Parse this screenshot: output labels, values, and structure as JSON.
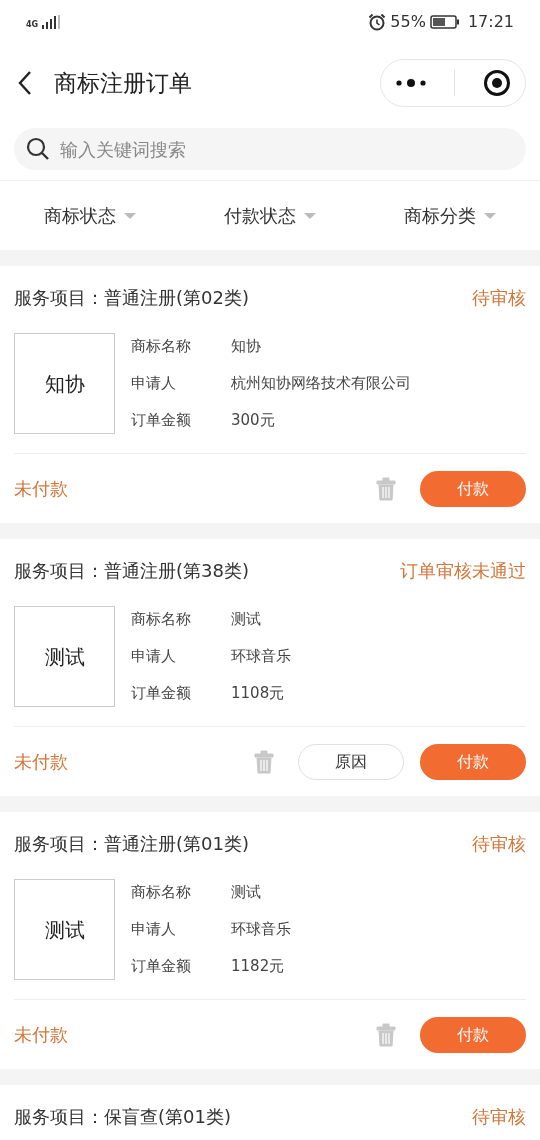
{
  "status_bar": {
    "network": "4G",
    "battery": "55%",
    "time": "17:21"
  },
  "header": {
    "title": "商标注册订单"
  },
  "search": {
    "placeholder": "输入关键词搜索"
  },
  "filters": [
    {
      "label": "商标状态"
    },
    {
      "label": "付款状态"
    },
    {
      "label": "商标分类"
    }
  ],
  "orders": [
    {
      "service_label": "服务项目：",
      "service": "普通注册(第02类)",
      "status": "待审核",
      "logo_text": "知协",
      "fields": [
        {
          "label": "商标名称",
          "value": "知协"
        },
        {
          "label": "申请人",
          "value": "杭州知协网络技术有限公司"
        },
        {
          "label": "订单金额",
          "value": "300元"
        }
      ],
      "payment_status": "未付款",
      "buttons": [
        {
          "kind": "delete"
        },
        {
          "kind": "pay",
          "label": "付款"
        }
      ]
    },
    {
      "service_label": "服务项目：",
      "service": "普通注册(第38类)",
      "status": "订单审核未通过",
      "logo_text": "测试",
      "fields": [
        {
          "label": "商标名称",
          "value": "测试"
        },
        {
          "label": "申请人",
          "value": "环球音乐"
        },
        {
          "label": "订单金额",
          "value": "1108元"
        }
      ],
      "payment_status": "未付款",
      "buttons": [
        {
          "kind": "delete"
        },
        {
          "kind": "reason",
          "label": "原因"
        },
        {
          "kind": "pay",
          "label": "付款"
        }
      ]
    },
    {
      "service_label": "服务项目：",
      "service": "普通注册(第01类)",
      "status": "待审核",
      "logo_text": "测试",
      "fields": [
        {
          "label": "商标名称",
          "value": "测试"
        },
        {
          "label": "申请人",
          "value": "环球音乐"
        },
        {
          "label": "订单金额",
          "value": "1182元"
        }
      ],
      "payment_status": "未付款",
      "buttons": [
        {
          "kind": "delete"
        },
        {
          "kind": "pay",
          "label": "付款"
        }
      ]
    },
    {
      "service_label": "服务项目：",
      "service": "保盲查(第01类)",
      "status": "待审核"
    }
  ]
}
